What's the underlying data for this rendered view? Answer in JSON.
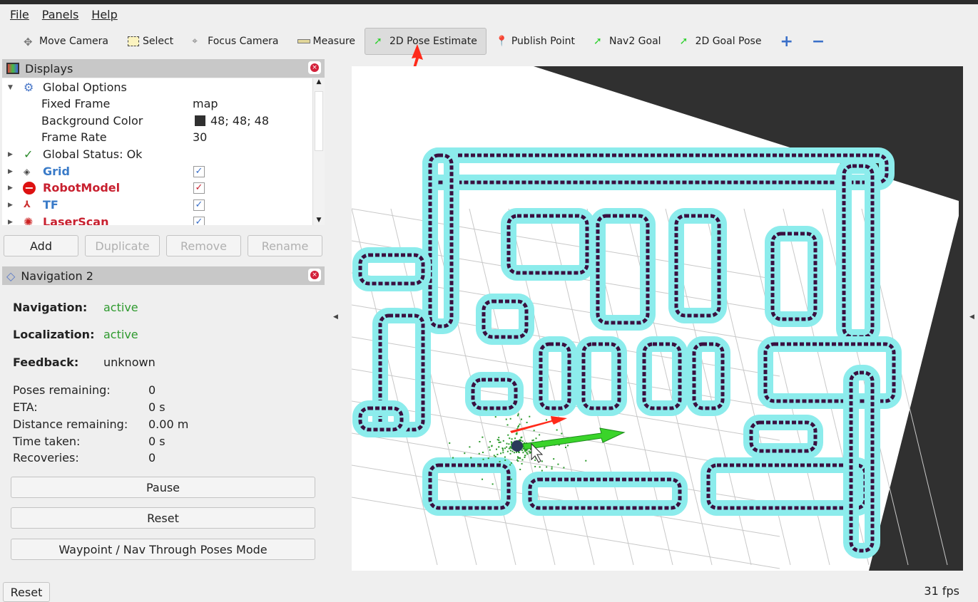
{
  "menu": [
    "File",
    "Panels",
    "Help"
  ],
  "toolbar": [
    {
      "label": "Move Camera",
      "icon": "move-camera-icon"
    },
    {
      "label": "Select",
      "icon": "select-icon"
    },
    {
      "label": "Focus Camera",
      "icon": "focus-camera-icon"
    },
    {
      "label": "Measure",
      "icon": "measure-icon"
    },
    {
      "label": "2D Pose Estimate",
      "icon": "pose-estimate-icon",
      "active": true
    },
    {
      "label": "Publish Point",
      "icon": "publish-point-icon"
    },
    {
      "label": "Nav2 Goal",
      "icon": "nav2-goal-icon"
    },
    {
      "label": "2D Goal Pose",
      "icon": "goal-pose-icon"
    }
  ],
  "displays": {
    "title": "Displays",
    "rows": [
      {
        "label": "Global Options"
      },
      {
        "label": "Fixed Frame",
        "value": "map"
      },
      {
        "label": "Background Color",
        "value": "48; 48; 48"
      },
      {
        "label": "Frame Rate",
        "value": "30"
      },
      {
        "label": "Global Status: Ok"
      },
      {
        "label": "Grid",
        "checked": true,
        "color": "#3a7bc8"
      },
      {
        "label": "RobotModel",
        "checked": true,
        "color": "#c8202f"
      },
      {
        "label": "TF",
        "checked": true,
        "color": "#3a7bc8"
      },
      {
        "label": "LaserScan",
        "checked": true,
        "color": "#c8202f"
      }
    ],
    "buttons": {
      "add": "Add",
      "duplicate": "Duplicate",
      "remove": "Remove",
      "rename": "Rename"
    }
  },
  "nav2": {
    "title": "Navigation 2",
    "navigation_label": "Navigation:",
    "navigation": "active",
    "localization_label": "Localization:",
    "localization": "active",
    "feedback_label": "Feedback:",
    "feedback": "unknown",
    "stats": [
      {
        "label": "Poses remaining:",
        "value": "0"
      },
      {
        "label": "ETA:",
        "value": "0 s"
      },
      {
        "label": "Distance remaining:",
        "value": "0.00 m"
      },
      {
        "label": "Time taken:",
        "value": "0 s"
      },
      {
        "label": "Recoveries:",
        "value": "0"
      }
    ],
    "pause": "Pause",
    "reset": "Reset",
    "mode": "Waypoint / Nav Through Poses Mode"
  },
  "status": {
    "reset": "Reset",
    "fps": "31 fps"
  },
  "colors": {
    "active": "#2e9a2e",
    "costmap": "#8cecec",
    "obstacle": "#3a1040",
    "background": "#303030"
  }
}
